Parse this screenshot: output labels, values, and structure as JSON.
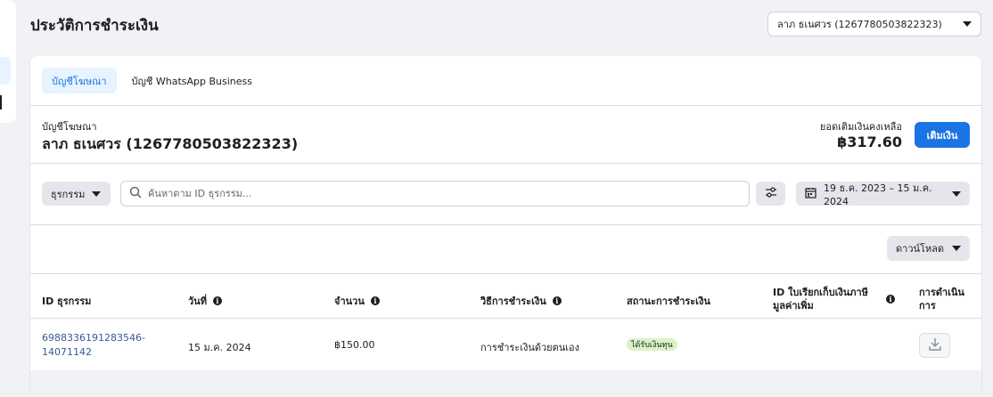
{
  "header": {
    "title": "ประวัติการชำระเงิน",
    "account_selector": "ลาภ ธเนศวร (1267780503822323)"
  },
  "tabs": [
    {
      "label": "บัญชีโฆษณา",
      "active": true
    },
    {
      "label": "บัญชี WhatsApp Business",
      "active": false
    }
  ],
  "account": {
    "type_label": "บัญชีโฆษณา",
    "name": "ลาภ ธเนศวร (1267780503822323)",
    "balance_label": "ยอดเติมเงินคงเหลือ",
    "balance": "฿317.60",
    "add_funds_label": "เติมเงิน"
  },
  "filters": {
    "type_dropdown": "ธุรกรรม",
    "search_placeholder": "ค้นหาตาม ID ธุรกรรม...",
    "date_range": "19 ธ.ค. 2023 – 15 ม.ค. 2024"
  },
  "download_label": "ดาวน์โหลด",
  "table": {
    "headers": {
      "txn_id": "ID ธุรกรรม",
      "date": "วันที่",
      "amount": "จำนวน",
      "method": "วิธีการชำระเงิน",
      "status": "สถานะการชำระเงิน",
      "invoice_line1": "ID ใบเรียกเก็บเงินภาษี",
      "invoice_line2": "มูลค่าเพิ่ม",
      "action_line1": "การดำเนิน",
      "action_line2": "การ"
    },
    "rows": [
      {
        "txn_id_line1": "6988336191283546-",
        "txn_id_line2": "14071142",
        "date": "15 ม.ค. 2024",
        "amount": "฿150.00",
        "method": "การชำระเงินด้วยตนเอง",
        "status": "ได้รับเงินทุน",
        "invoice": ""
      }
    ]
  },
  "colors": {
    "accent": "#1b74e4",
    "link": "#385898",
    "status_paid_bg": "#d8f3c6",
    "page_bg": "#f0f2f5"
  }
}
